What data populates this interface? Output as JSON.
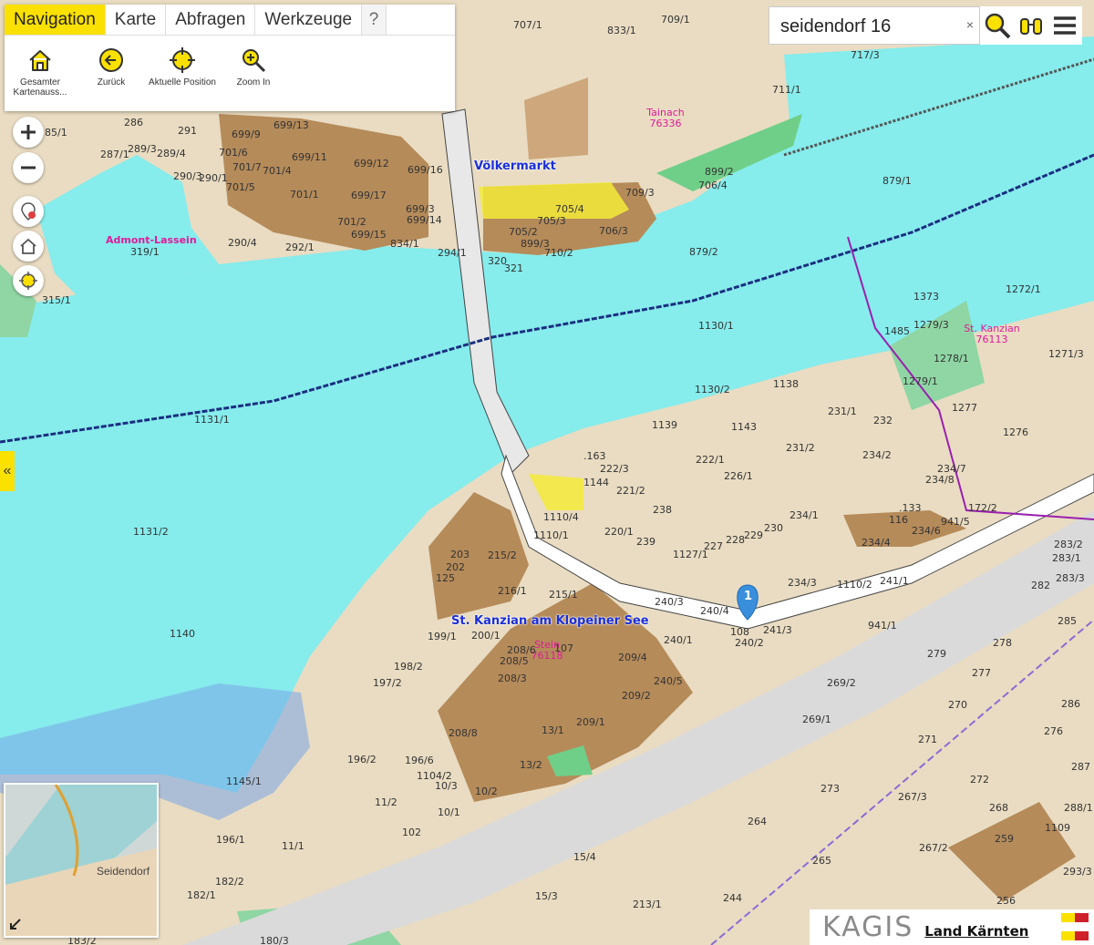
{
  "menu": {
    "tabs": [
      {
        "label": "Navigation",
        "active": true
      },
      {
        "label": "Karte",
        "active": false
      },
      {
        "label": "Abfragen",
        "active": false
      },
      {
        "label": "Werkzeuge",
        "active": false
      },
      {
        "label": "?",
        "active": false
      }
    ],
    "tools": [
      {
        "label": "Gesamter Kartenauss...",
        "icon": "home-icon"
      },
      {
        "label": "Zurück",
        "icon": "back-arrow-icon"
      },
      {
        "label": "Aktuelle Position",
        "icon": "crosshair-icon"
      },
      {
        "label": "Zoom In",
        "icon": "zoom-in-icon"
      }
    ]
  },
  "search": {
    "value": "seidendorf 16",
    "clear_label": "×"
  },
  "controls": {
    "collapse_label": "«"
  },
  "marker": {
    "label": "1"
  },
  "overview": {
    "label": "Seidendorf"
  },
  "logo": {
    "kagis": "KAGIS",
    "land": "Land Kärnten",
    "badge": "KAGIS"
  },
  "colors": {
    "accent": "#fbe100",
    "river": "#86ecec",
    "land": "#e9dcc2",
    "parcel_brown": "#b58b5a",
    "green": "#6fcf88",
    "pink": "#e01a9a",
    "blue_label": "#1a2fd8",
    "marker": "#3a8fdc"
  },
  "place_labels": [
    {
      "text": "Völkermarkt",
      "style": "blue"
    },
    {
      "text": "St. Kanzian am Klopeiner See",
      "style": "blue"
    },
    {
      "text": "Tainach 76336",
      "style": "pink"
    },
    {
      "text": "Admont-Lassein",
      "style": "pink"
    },
    {
      "text": "St. Kanzian 76113",
      "style": "pink"
    },
    {
      "text": "Stein 76118",
      "style": "pink"
    }
  ],
  "parcel_labels": [
    "707/1",
    "709/1",
    "833/1",
    "711/1",
    "717/3",
    "879/1",
    "879/2",
    "286",
    "291",
    "287/1",
    "289/3",
    "289/4",
    "285/1",
    "699/9",
    "699/13",
    "699/12",
    "699/16",
    "699/17",
    "701/6",
    "701/7",
    "701/5",
    "701/4",
    "701/1",
    "699/11",
    "290/3",
    "290/1",
    "290/4",
    "292/1",
    "701/2",
    "699/15",
    "834/1",
    "294/1",
    "699/3",
    "699/14",
    "709/3",
    "705/4",
    "705/3",
    "705/2",
    "899/3",
    "710/2",
    "706/3",
    "899/2",
    "706/4",
    "320",
    "321",
    "319/1",
    "315/1",
    "1373",
    "1272/1",
    "1279/3",
    "1485",
    "1278/1",
    "1271/3",
    "1279/1",
    "1130/1",
    "1130/2",
    "1138",
    "1131/1",
    "1131/2",
    "1139",
    "1143",
    "231/1",
    "232",
    "1277",
    "1276",
    "231/2",
    "234/2",
    "234/7",
    "234/8",
    "222/1",
    "226/1",
    ".163",
    "222/3",
    "221/2",
    "1144",
    "238",
    "1110/4",
    "1110/1",
    "220/1",
    "239",
    "1127/1",
    "227",
    "228",
    "229",
    "230",
    "234/1",
    ".133",
    "116",
    "234/6",
    "234/4",
    "941/5",
    "172/2",
    "283/2",
    "283/1",
    "283/3",
    "282",
    "203",
    "202",
    "125",
    "215/2",
    "216/1",
    "215/1",
    "240/3",
    "240/4",
    "234/3",
    "1110/2",
    "241/1",
    "941/1",
    "285",
    "241/3",
    "108",
    "240/2",
    "278",
    "279",
    "277",
    "240/1",
    "199/1",
    "200/1",
    "208/6",
    "208/5",
    "208/3",
    "107",
    "209/4",
    "240/5",
    "209/2",
    "209/1",
    "198/2",
    "197/2",
    "1140",
    "269/2",
    "269/1",
    "270",
    "286",
    "276",
    "271",
    "287",
    "272",
    "273",
    "267/3",
    "268",
    "288/1",
    "1109",
    "259",
    "267/2",
    "264",
    "265",
    "293/3",
    "256",
    "244",
    "213/1",
    "15/4",
    "15/3",
    "13/1",
    "13/2",
    "10/2",
    "10/1",
    "10/3",
    "1104/2",
    "208/8",
    "196/6",
    "196/2",
    "11/2",
    "102",
    "1145/1",
    "196/1",
    "11/1",
    "182/2",
    "182/1",
    "183/2",
    "180/3"
  ]
}
